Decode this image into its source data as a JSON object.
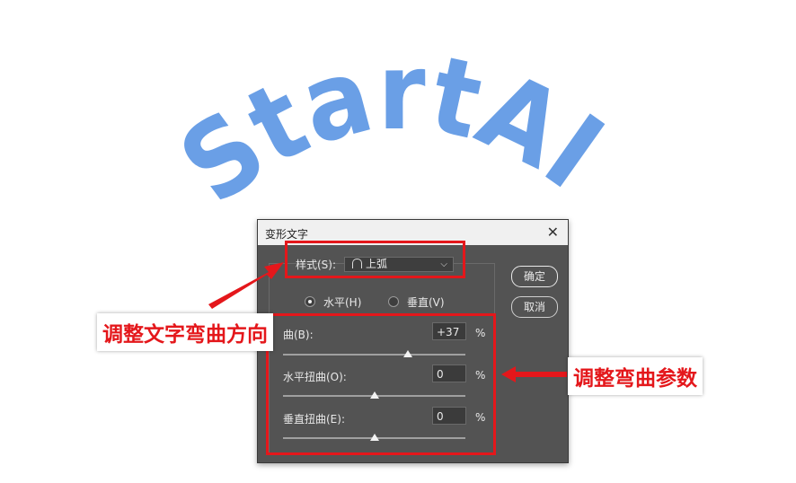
{
  "art": {
    "text": "StartAI",
    "color": "#6a9fe6"
  },
  "dialog": {
    "title": "变形文字",
    "close_icon": "close-icon",
    "style": {
      "label": "样式(S):",
      "value": "上弧",
      "icon": "arc-upper-icon"
    },
    "orientation": {
      "horizontal": {
        "label": "水平(H)",
        "selected": true
      },
      "vertical": {
        "label": "垂直(V)",
        "selected": false
      }
    },
    "bend": {
      "label": "曲(B):",
      "value": "+37",
      "unit": "%",
      "slider": 37
    },
    "h_distort": {
      "label": "水平扭曲(O):",
      "value": "0",
      "unit": "%",
      "slider": 0
    },
    "v_distort": {
      "label": "垂直扭曲(E):",
      "value": "0",
      "unit": "%",
      "slider": 0
    },
    "ok_label": "确定",
    "cancel_label": "取消"
  },
  "annotations": {
    "direction_label": "调整文字弯曲方向",
    "params_label": "调整弯曲参数",
    "color": "#e4171b"
  }
}
